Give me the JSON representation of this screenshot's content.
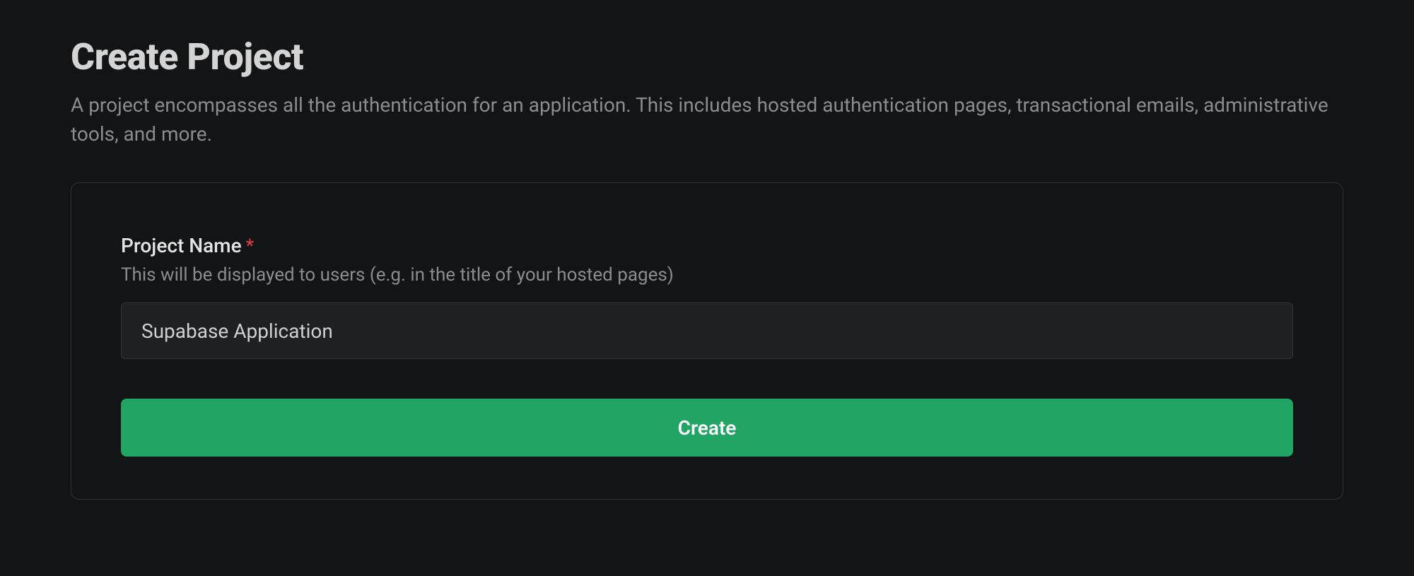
{
  "header": {
    "title": "Create Project",
    "description": "A project encompasses all the authentication for an application. This includes hosted authentication pages, transactional emails, administrative tools, and more."
  },
  "form": {
    "projectName": {
      "label": "Project Name",
      "required_marker": "*",
      "helper": "This will be displayed to users (e.g. in the title of your hosted pages)",
      "value": "Supabase Application"
    },
    "submit_label": "Create"
  },
  "colors": {
    "accent": "#22a465",
    "required": "#e23d3d"
  }
}
